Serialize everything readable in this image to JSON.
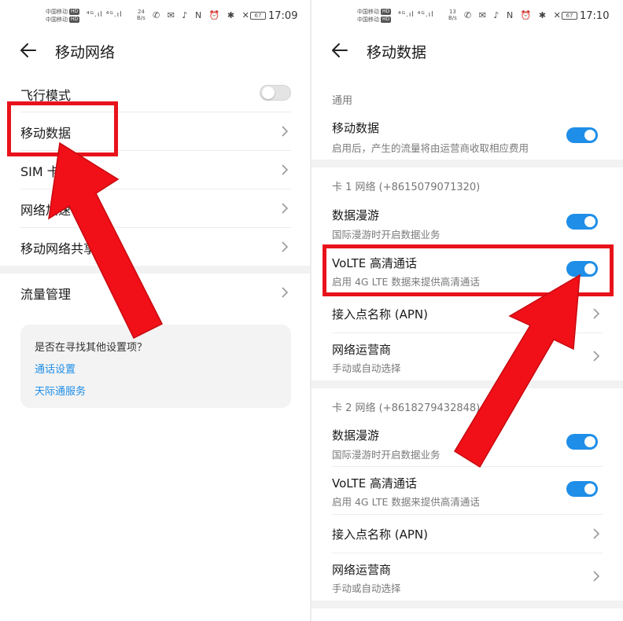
{
  "colors": {
    "accent": "#1e8ee8",
    "highlight": "#e8121b",
    "toggle_on": "#1e8ee8",
    "toggle_off": "#e4e4e4"
  },
  "left": {
    "status": {
      "carrier1": "中国移动",
      "carrier2": "中国移动",
      "hd": "HD",
      "signal": "⁴ᴳ.ıl ⁴ᴳ.ıl",
      "speed_value": "24",
      "speed_unit": "B/s",
      "icons": "✆ ✉ ♪  N ⏰ ✱ ✕",
      "battery": "67",
      "time": "17:09"
    },
    "header": {
      "title": "移动网络",
      "back_icon": "arrow-left-icon"
    },
    "items": [
      {
        "label": "飞行模式",
        "control": "toggle-off"
      },
      {
        "label": "移动数据",
        "control": "chevron"
      },
      {
        "label": "SIM 卡管理",
        "control": "chevron"
      },
      {
        "label": "网络加速",
        "control": "chevron"
      },
      {
        "label": "移动网络共享",
        "control": "chevron"
      },
      {
        "label": "流量管理",
        "control": "chevron"
      }
    ],
    "suggest": {
      "question": "是否在寻找其他设置项？",
      "links": [
        "通话设置",
        "天际通服务"
      ]
    }
  },
  "right": {
    "status": {
      "carrier1": "中国移动",
      "carrier2": "中国移动",
      "hd": "HD",
      "signal": "⁴ᴳ.ıl ⁴ᴳ.ıl",
      "speed_value": "13",
      "speed_unit": "B/s",
      "icons": "✆ ✉ ♪  N ⏰ ✱ ✕",
      "battery": "67",
      "time": "17:10"
    },
    "header": {
      "title": "移动数据",
      "back_icon": "arrow-left-icon"
    },
    "general": {
      "heading": "通用",
      "mobile_data": {
        "label": "移动数据",
        "sub": "启用后，产生的流量将由运营商收取相应费用",
        "on": true
      }
    },
    "sim1": {
      "heading": "卡 1 网络 (+8615079071320)",
      "roaming": {
        "label": "数据漫游",
        "sub": "国际漫游时开启数据业务",
        "on": true
      },
      "volte": {
        "label": "VoLTE 高清通话",
        "sub": "启用 4G LTE 数据来提供高清通话",
        "on": true
      },
      "apn": {
        "label": "接入点名称 (APN)"
      },
      "operator": {
        "label": "网络运营商",
        "sub": "手动或自动选择"
      }
    },
    "sim2": {
      "heading": "卡 2 网络 (+8618279432848)",
      "roaming": {
        "label": "数据漫游",
        "sub": "国际漫游时开启数据业务",
        "on": true
      },
      "volte": {
        "label": "VoLTE 高清通话",
        "sub": "启用 4G LTE 数据来提供高清通话",
        "on": true
      },
      "apn": {
        "label": "接入点名称 (APN)"
      },
      "operator": {
        "label": "网络运营商",
        "sub": "手动或自动选择"
      }
    }
  }
}
